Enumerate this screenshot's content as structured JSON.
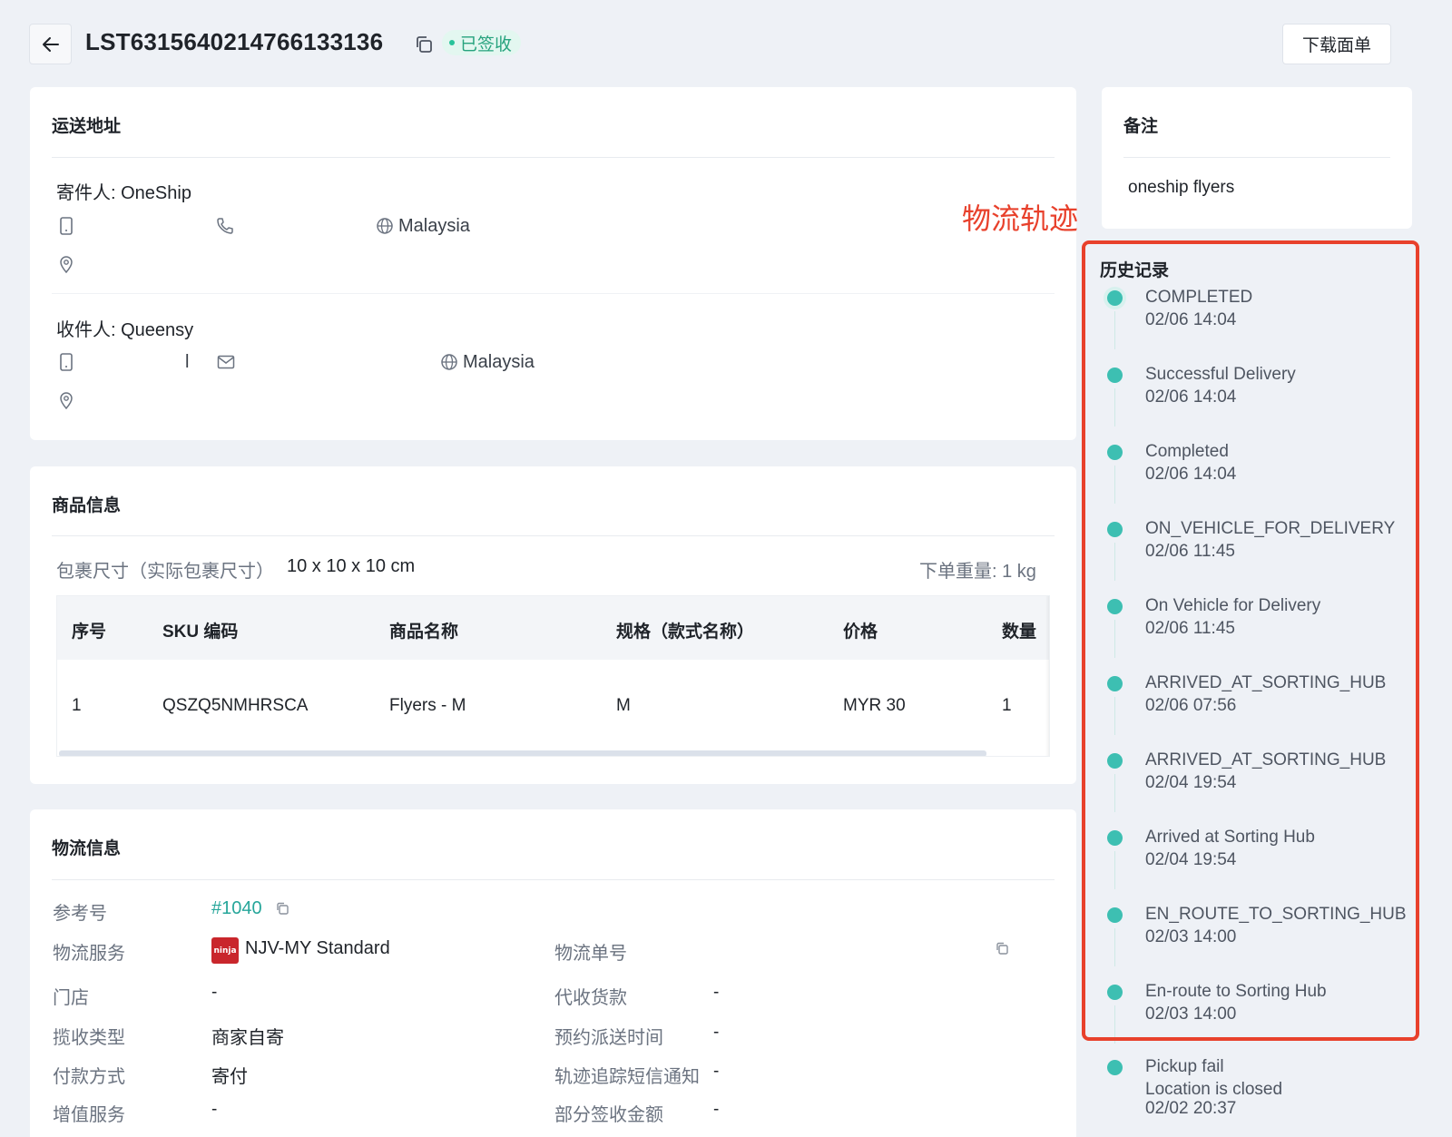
{
  "header": {
    "order_id": "LST6315640214766133136",
    "status": "已签收",
    "download_label": "下载面单"
  },
  "address": {
    "title": "运送地址",
    "sender_label": "寄件人: OneShip",
    "sender_country": "Malaysia",
    "receiver_label": "收件人: Queensy",
    "receiver_partial": "l",
    "receiver_country": "Malaysia"
  },
  "product": {
    "title": "商品信息",
    "size_label": "包裹尺寸（实际包裹尺寸）",
    "size_value": "10 x 10 x 10 cm",
    "weight": "下单重量: 1 kg",
    "columns": [
      "序号",
      "SKU 编码",
      "商品名称",
      "规格（款式名称）",
      "价格",
      "数量"
    ],
    "rows": [
      [
        "1",
        "QSZQ5NMHRSCA",
        "Flyers - M",
        "M",
        "MYR 30",
        "1"
      ]
    ]
  },
  "logistics": {
    "title": "物流信息",
    "ref_label": "参考号",
    "ref_value": "#1040",
    "service_label": "物流服务",
    "service_value": "NJV-MY Standard",
    "service_logo_text": "ninja",
    "tracking_label": "物流单号",
    "store_label": "门店",
    "store_value": "-",
    "cod_label": "代收货款",
    "cod_value": "-",
    "pickup_label": "揽收类型",
    "pickup_value": "商家自寄",
    "schedule_label": "预约派送时间",
    "schedule_value": "-",
    "pay_label": "付款方式",
    "pay_value": "寄付",
    "sms_label": "轨迹追踪短信通知",
    "sms_value": "-",
    "extra_label": "增值服务",
    "extra_value": "-",
    "partial_label": "部分签收金额",
    "partial_value": "-"
  },
  "notes": {
    "title": "备注",
    "content": "oneship flyers"
  },
  "annotation": "物流轨迹",
  "history": {
    "title": "历史记录",
    "events": [
      {
        "status": "COMPLETED",
        "time": "02/06 14:04"
      },
      {
        "status": "Successful Delivery",
        "time": "02/06 14:04"
      },
      {
        "status": "Completed",
        "time": "02/06 14:04"
      },
      {
        "status": "ON_VEHICLE_FOR_DELIVERY",
        "time": "02/06 11:45"
      },
      {
        "status": "On Vehicle for Delivery",
        "time": "02/06 11:45"
      },
      {
        "status": "ARRIVED_AT_SORTING_HUB",
        "time": "02/06 07:56"
      },
      {
        "status": "ARRIVED_AT_SORTING_HUB",
        "time": "02/04 19:54"
      },
      {
        "status": "Arrived at Sorting Hub",
        "time": "02/04 19:54"
      },
      {
        "status": "EN_ROUTE_TO_SORTING_HUB",
        "time": "02/03 14:00"
      },
      {
        "status": "En-route to Sorting Hub",
        "time": "02/03 14:00"
      }
    ],
    "last_status": "Pickup fail",
    "last_detail": "Location is closed",
    "last_time": "02/02 20:37"
  },
  "colors": {
    "accent": "#26a69a",
    "annotation_red": "#e8412c",
    "timeline_dot": "#3dbfb2"
  }
}
